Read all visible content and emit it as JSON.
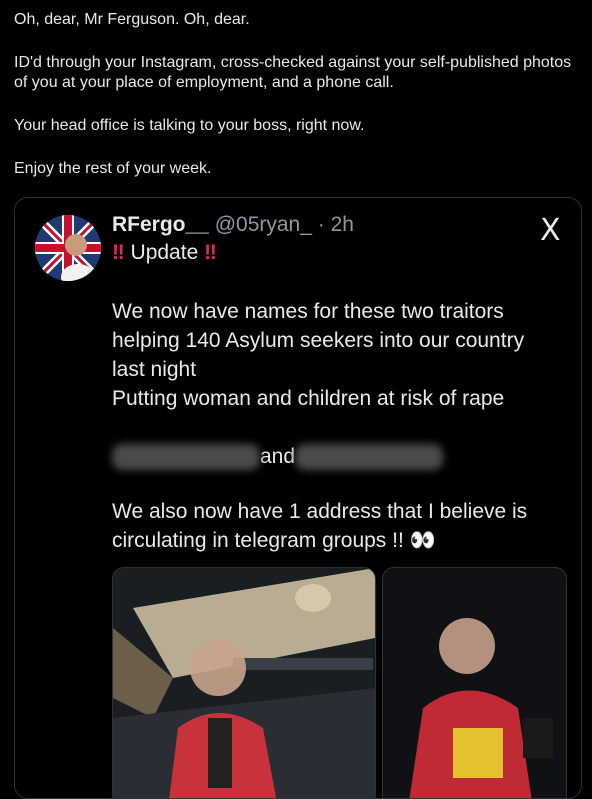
{
  "post": {
    "line1": "Oh, dear, Mr Ferguson. Oh, dear.",
    "line2": "ID'd through your Instagram, cross-checked against your self-published photos of you at your place of employment, and a phone call.",
    "line3": "Your head office is talking to your boss, right now.",
    "line4": "Enjoy the rest of your week."
  },
  "embed": {
    "display_name": "RFergo__",
    "handle_time": "@05ryan_ · 2h",
    "x_logo": "X",
    "bang": "‼",
    "update_word": "Update",
    "paragraph1": "We now have names for these two traitors helping 140 Asylum seekers into our country last night",
    "paragraph2": "Putting  woman and children at risk of rape",
    "and_word": "and",
    "paragraph3": "We also now have 1 address that I believe is circulating in telegram groups  !!",
    "eyes": "👀"
  },
  "colors": {
    "background": "#000000",
    "text": "#e7e9ea",
    "muted": "#8b98a5",
    "accent": "#e0245e",
    "border": "#2f3336"
  },
  "icons": {
    "logo": "x-logo-icon",
    "emoji": "eyes-emoji-icon"
  }
}
